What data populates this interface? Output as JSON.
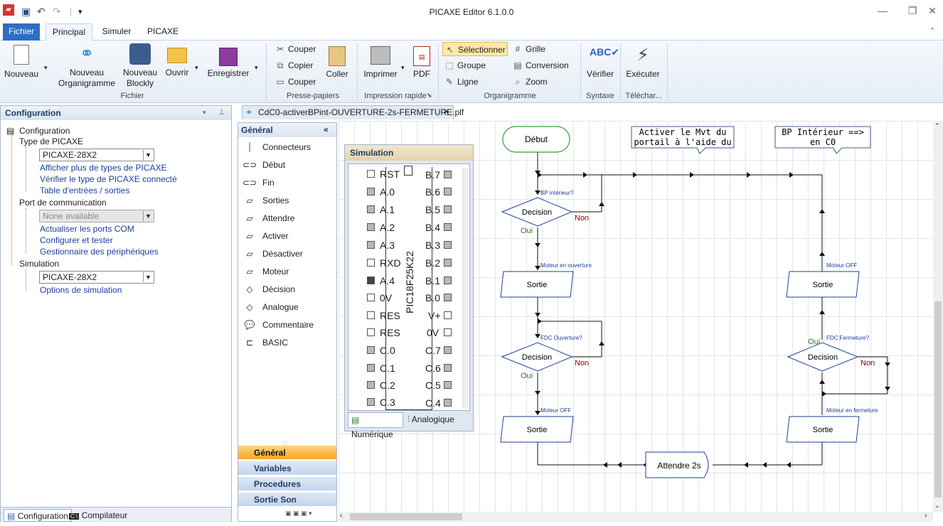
{
  "window": {
    "title": "PICAXE Editor 6.1.0.0"
  },
  "tabs": [
    {
      "label": "Fichier"
    },
    {
      "label": "Principal"
    },
    {
      "label": "Simuler"
    },
    {
      "label": "PICAXE"
    }
  ],
  "ribbon": {
    "fichier": {
      "nouveau": "Nouveau",
      "nouveau_organigramme_1": "Nouveau",
      "nouveau_organigramme_2": "Organigramme",
      "nouveau_blockly_1": "Nouveau",
      "nouveau_blockly_2": "Blockly",
      "ouvrir": "Ouvrir",
      "enregistrer": "Enregistrer",
      "group": "Fichier"
    },
    "presse_papiers": {
      "couper": "Couper",
      "copier": "Copier",
      "couper2": "Couper",
      "coller": "Coller",
      "group": "Presse-papiers"
    },
    "impression": {
      "imprimer": "Imprimer",
      "pdf": "PDF",
      "group": "Impression rapide"
    },
    "organigramme": {
      "selectionner": "Sélectionner",
      "groupe": "Groupe",
      "ligne": "Ligne",
      "grille": "Grille",
      "conversion": "Conversion",
      "zoom": "Zoom",
      "group": "Organigramme"
    },
    "syntaxe": {
      "verifier": "Vérifier",
      "group": "Syntaxe"
    },
    "telechar": {
      "executer": "Exécuter",
      "group": "Téléchar..."
    }
  },
  "left_panel": {
    "title": "Configuration",
    "root": "Configuration",
    "type_picaxe": "Type de PICAXE",
    "picaxe_select": "PICAXE-28X2",
    "link_afficher": "Afficher plus de types de PICAXE",
    "link_verifier": "Vérifier le type de PICAXE connecté",
    "link_table": "Table d'entrées / sorties",
    "port_comm": "Port de communication",
    "port_select": "None available",
    "link_actualiser": "Actualiser les ports COM",
    "link_configurer": "Configurer et tester",
    "link_gestionnaire": "Gestionnaire des périphériques",
    "simulation": "Simulation",
    "sim_select": "PICAXE-28X2",
    "link_options": "Options de simulation",
    "bottom_tabs": [
      "Configuration",
      "Compilateur"
    ]
  },
  "document_tab": {
    "label": "CdC0-activerBPint-OUVERTURE-2s-FERMETURE.plf"
  },
  "palette": {
    "title": "Général",
    "items": [
      "Connecteurs",
      "Début",
      "Fin",
      "Sorties",
      "Attendre",
      "Activer",
      "Désactiver",
      "Moteur",
      "Décision",
      "Analogue",
      "Commentaire",
      "BASIC"
    ],
    "categories": [
      "Général",
      "Variables",
      "Procedures",
      "Sortie Son"
    ]
  },
  "simulation": {
    "title": "Simulation",
    "chip_label": "PIC18F25K22",
    "left_pins": [
      "RST",
      "A.0",
      "A.1",
      "A.2",
      "A.3",
      "RXD",
      "A.4",
      "0V",
      "RES",
      "RES",
      "C.0",
      "C.1",
      "C.2",
      "C.3"
    ],
    "right_pins": [
      "B.7",
      "B.6",
      "B.5",
      "B.4",
      "B.3",
      "B.2",
      "B.1",
      "B.0",
      "V+",
      "0V",
      "C.7",
      "C.6",
      "C.5",
      "C.4"
    ],
    "tabs": [
      "Numérique",
      "Analogique"
    ]
  },
  "flowchart": {
    "debut": "Début",
    "comment1_l1": "Activer le Mvt du",
    "comment1_l2": "portail à l'aide du",
    "comment2_l1": "BP Intérieur  ==>",
    "comment2_l2": "en C0",
    "dec1_label": "BP intérieur?",
    "decision": "Decision",
    "non": "Non",
    "oui": "Oui",
    "out1_label": "Moteur en ouverture",
    "sortie": "Sortie",
    "dec2_label": "FDC Ouverture?",
    "out2_label": "Moteur OFF",
    "wait": "Attendre 2s",
    "out3_label": "Moteur en fermeture",
    "dec3_label": "FDC Fermeture?",
    "out4_label": "Moteur OFF"
  }
}
